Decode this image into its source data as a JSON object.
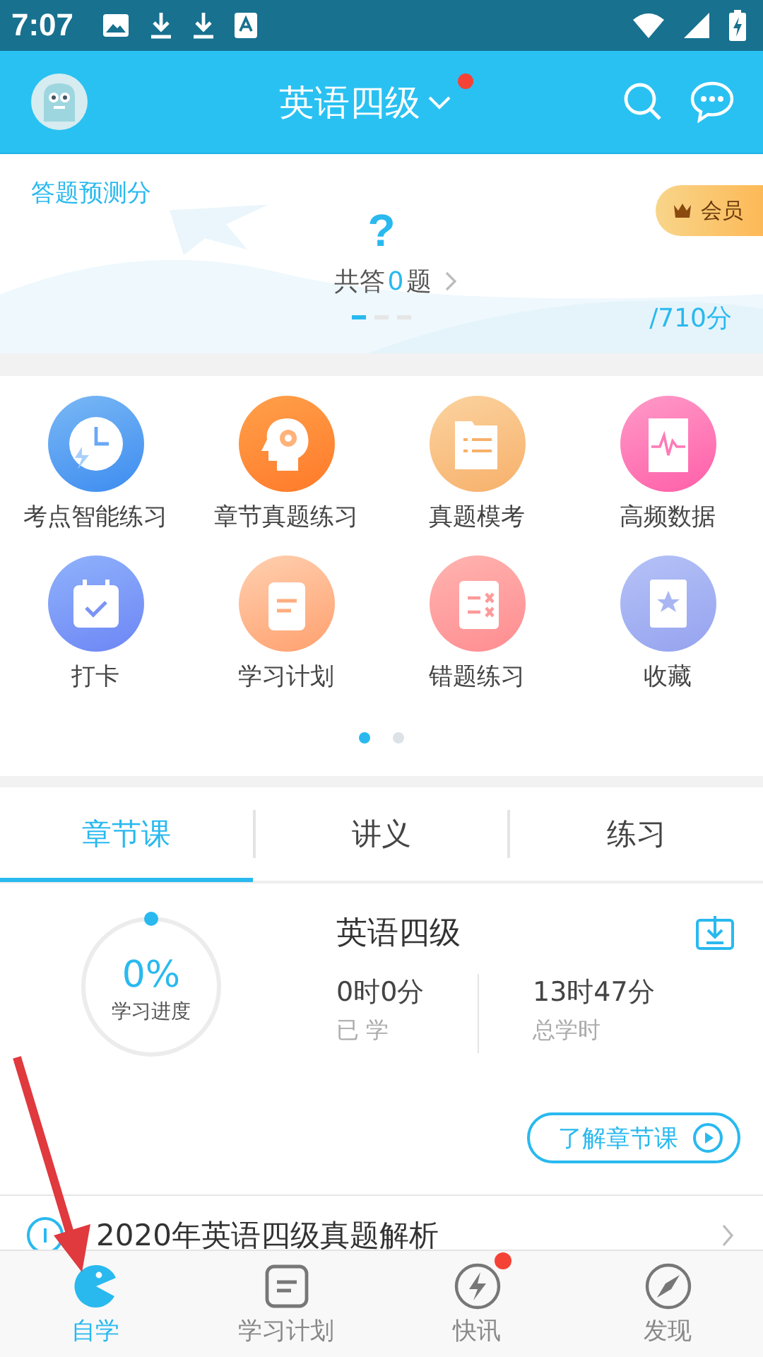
{
  "status_bar": {
    "time": "7:07"
  },
  "header": {
    "title": "英语四级",
    "unread": true
  },
  "banner": {
    "label": "答题预测分",
    "score": "?",
    "answered_prefix": "共答",
    "answered_count": "0",
    "answered_suffix": "题",
    "member": "会员",
    "total": "/710分",
    "pager": [
      {
        "selected": true
      },
      {
        "selected": false
      },
      {
        "selected": false
      }
    ]
  },
  "features": {
    "items": [
      {
        "label": "考点智能练习",
        "kind": "clock"
      },
      {
        "label": "章节真题练习",
        "kind": "head"
      },
      {
        "label": "真题模考",
        "kind": "folder"
      },
      {
        "label": "高频数据",
        "kind": "chart"
      },
      {
        "label": "打卡",
        "kind": "calendar"
      },
      {
        "label": "学习计划",
        "kind": "clipboard"
      },
      {
        "label": "错题练习",
        "kind": "checklist"
      },
      {
        "label": "收藏",
        "kind": "book"
      }
    ],
    "pager": [
      {
        "selected": true
      },
      {
        "selected": false
      }
    ]
  },
  "tabs": [
    {
      "label": "章节课",
      "selected": true
    },
    {
      "label": "讲义",
      "selected": false
    },
    {
      "label": "练习",
      "selected": false
    }
  ],
  "course": {
    "progress": "0%",
    "progress_label": "学习进度",
    "level": 0,
    "title": "英语四级",
    "stats": [
      {
        "value": "0时0分",
        "label": "已 学"
      },
      {
        "value": "13时47分",
        "label": "总学时"
      }
    ],
    "button": "了解章节课"
  },
  "list": [
    {
      "title": "2020年英语四级真题解析"
    }
  ],
  "nav": [
    {
      "label": "自学",
      "kind": "self",
      "selected": true,
      "badge": false
    },
    {
      "label": "学习计划",
      "kind": "plan",
      "selected": false,
      "badge": false
    },
    {
      "label": "快讯",
      "kind": "news",
      "selected": false,
      "badge": true
    },
    {
      "label": "发现",
      "kind": "discover",
      "selected": false,
      "badge": false
    }
  ]
}
